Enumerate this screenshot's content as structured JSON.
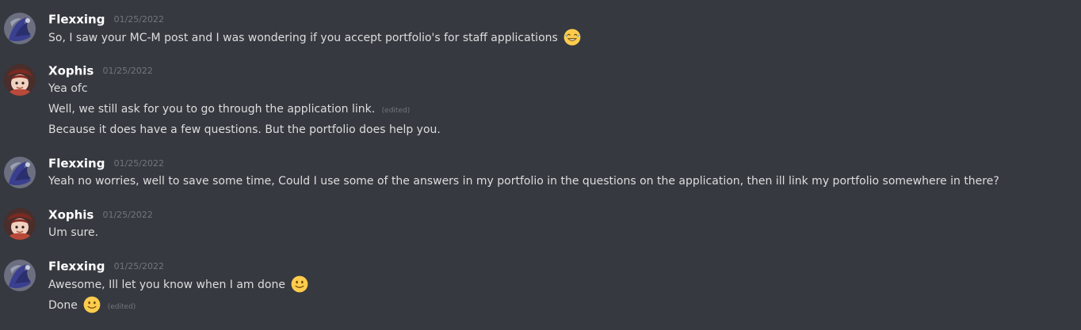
{
  "colors": {
    "background": "#36393f",
    "username": "#ffffff",
    "message_text": "#dcddde",
    "timestamp": "#72767d"
  },
  "messages": [
    {
      "author": "Flexxing",
      "timestamp": "01/25/2022",
      "lines": [
        {
          "text": "So, I saw your MC-M post and I was wondering if you accept portfolio's for staff applications",
          "emoji": "joy-emoji"
        }
      ]
    },
    {
      "author": "Xophis",
      "timestamp": "01/25/2022",
      "lines": [
        {
          "text": "Yea ofc"
        },
        {
          "text": "Well, we still ask for you to go through the application link.",
          "edited": "(edited)"
        },
        {
          "text": "Because it does have a few questions. But the portfolio does help you."
        }
      ]
    },
    {
      "author": "Flexxing",
      "timestamp": "01/25/2022",
      "lines": [
        {
          "text": "Yeah no worries, well to save some time, Could I use some of the answers in my portfolio in the questions on the application, then ill link my portfolio somewhere in there?"
        }
      ]
    },
    {
      "author": "Xophis",
      "timestamp": "01/25/2022",
      "lines": [
        {
          "text": "Um sure."
        }
      ]
    },
    {
      "author": "Flexxing",
      "timestamp": "01/25/2022",
      "lines": [
        {
          "text": "Awesome, Ill let you know when I am done",
          "emoji": "slight-smile-emoji"
        },
        {
          "text": "Done",
          "emoji": "slight-smile-emoji",
          "edited": "(edited)"
        }
      ]
    }
  ]
}
